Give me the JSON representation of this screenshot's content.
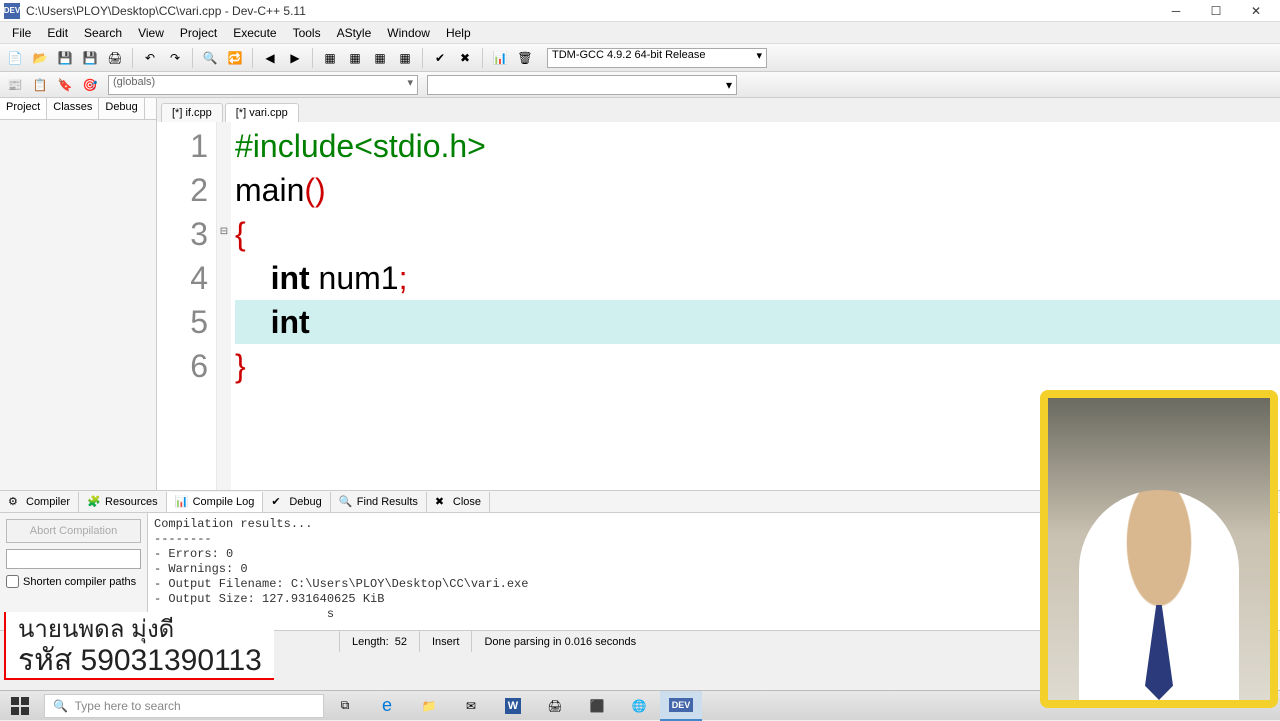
{
  "window": {
    "title": "C:\\Users\\PLOY\\Desktop\\CC\\vari.cpp - Dev-C++ 5.11",
    "icon_label": "DEV"
  },
  "menu": [
    "File",
    "Edit",
    "Search",
    "View",
    "Project",
    "Execute",
    "Tools",
    "AStyle",
    "Window",
    "Help"
  ],
  "compiler_select": "TDM-GCC 4.9.2 64-bit Release",
  "globals_label": "(globals)",
  "sidebar_tabs": {
    "project": "Project",
    "classes": "Classes",
    "debug": "Debug"
  },
  "file_tabs": [
    {
      "label": "[*] if.cpp",
      "active": false
    },
    {
      "label": "[*] vari.cpp",
      "active": true
    }
  ],
  "code": {
    "lines": [
      {
        "n": "1",
        "tokens": [
          {
            "t": "#include<stdio.h>",
            "cls": "kw-green"
          }
        ]
      },
      {
        "n": "2",
        "tokens": [
          {
            "t": "main",
            "cls": ""
          },
          {
            "t": "()",
            "cls": "kw-red"
          }
        ]
      },
      {
        "n": "3",
        "tokens": [
          {
            "t": "{",
            "cls": "kw-red"
          }
        ],
        "fold": "⊟"
      },
      {
        "n": "4",
        "tokens": [
          {
            "t": "    ",
            "cls": ""
          },
          {
            "t": "int",
            "cls": "kw-bold"
          },
          {
            "t": " num1",
            "cls": ""
          },
          {
            "t": ";",
            "cls": "kw-red"
          }
        ]
      },
      {
        "n": "5",
        "tokens": [
          {
            "t": "    ",
            "cls": ""
          },
          {
            "t": "int",
            "cls": "kw-bold"
          }
        ],
        "hl": true
      },
      {
        "n": "6",
        "tokens": [
          {
            "t": "}",
            "cls": "kw-red"
          }
        ]
      }
    ]
  },
  "bottom_tabs": {
    "compiler": "Compiler",
    "resources": "Resources",
    "compile_log": "Compile Log",
    "debug": "Debug",
    "find_results": "Find Results",
    "close": "Close"
  },
  "bottom_left": {
    "abort": "Abort Compilation",
    "shorten": "Shorten compiler paths"
  },
  "compile_log": "Compilation results...\n--------\n- Errors: 0\n- Warnings: 0\n- Output Filename: C:\\Users\\PLOY\\Desktop\\CC\\vari.exe\n- Output Size: 127.931640625 KiB\n                        s",
  "status": {
    "length_label": "Length:",
    "length_value": "52",
    "insert": "Insert",
    "parse": "Done parsing in 0.016 seconds"
  },
  "taskbar": {
    "search_placeholder": "Type here to search"
  },
  "overlay": {
    "line1": "นายนพดล มุ่งดี",
    "line2_label": "รหัส ",
    "line2_value": "59031390113"
  }
}
